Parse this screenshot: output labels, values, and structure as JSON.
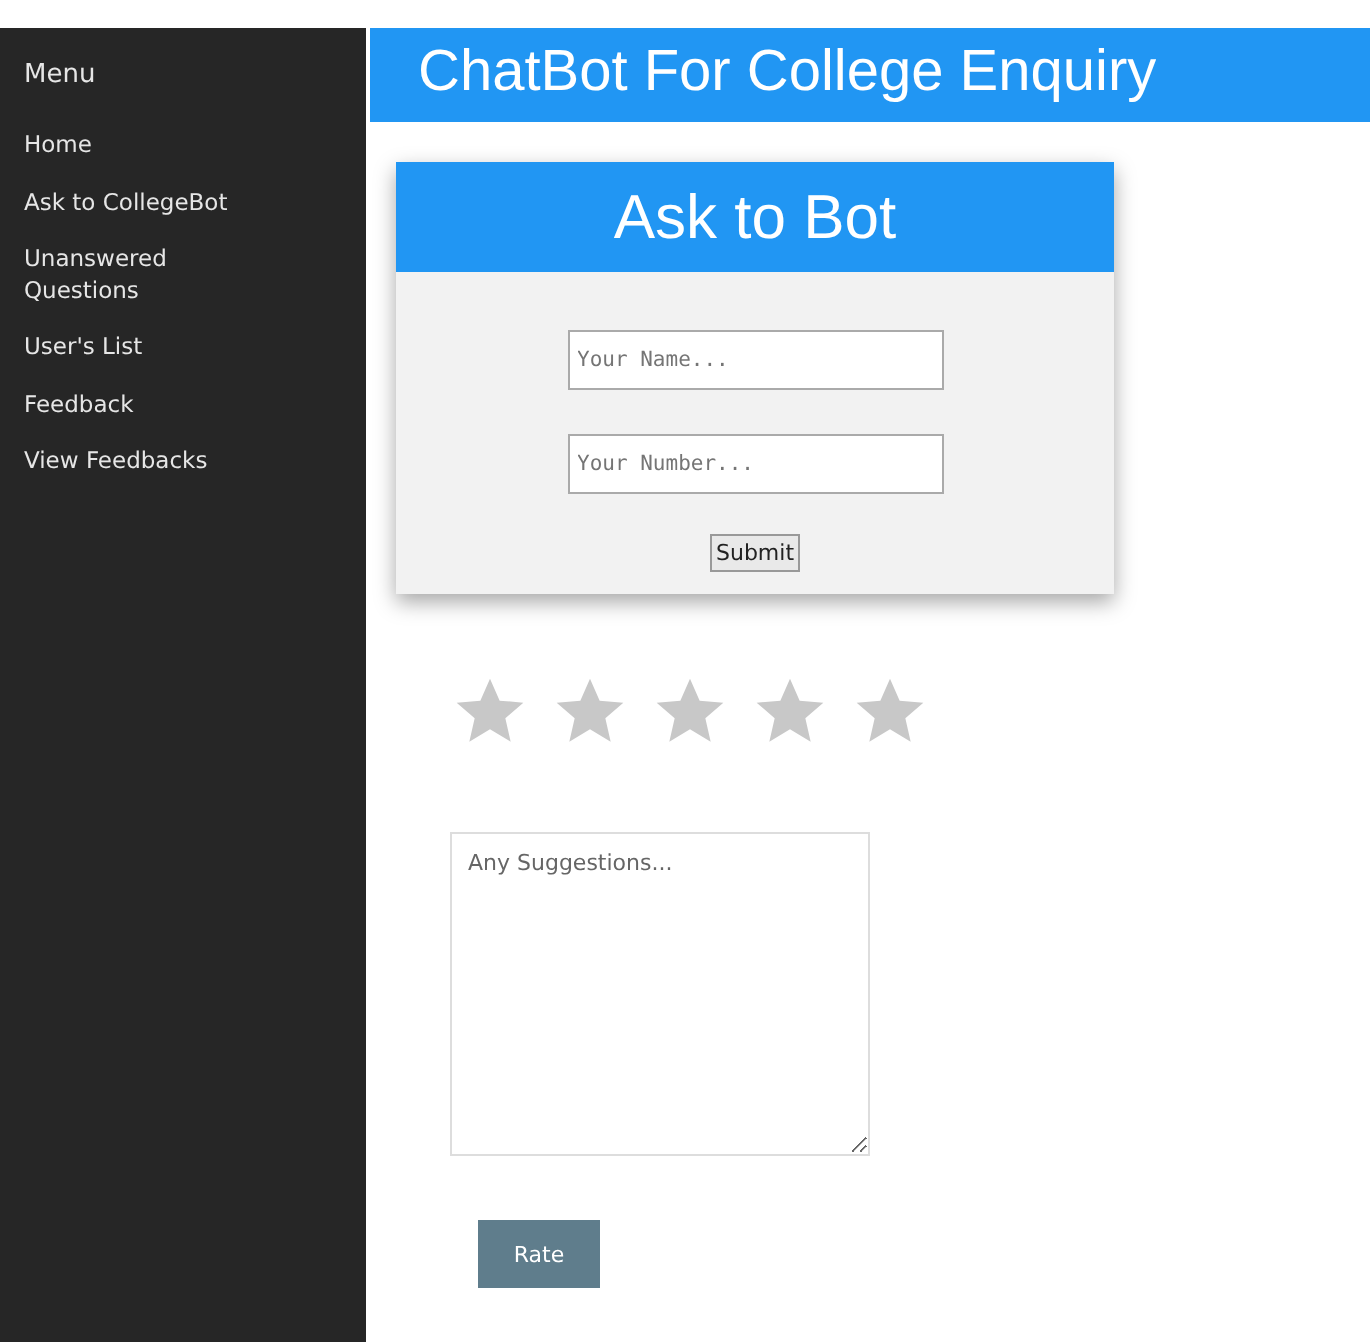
{
  "sidebar": {
    "title": "Menu",
    "items": [
      {
        "label": "Home"
      },
      {
        "label": "Ask to CollegeBot"
      },
      {
        "label": "Unanswered Questions"
      },
      {
        "label": "User's List"
      },
      {
        "label": "Feedback"
      },
      {
        "label": "View Feedbacks"
      }
    ]
  },
  "header": {
    "title": "ChatBot For College Enquiry"
  },
  "dialog": {
    "title": "Ask to Bot",
    "fields": [
      {
        "placeholder": "Your Name..."
      },
      {
        "placeholder": "Your Number..."
      }
    ],
    "submit": "Submit"
  },
  "feedback": {
    "stars": 0,
    "suggestions": {
      "placeholder": "Any Suggestions..."
    },
    "button": "Rate"
  }
}
